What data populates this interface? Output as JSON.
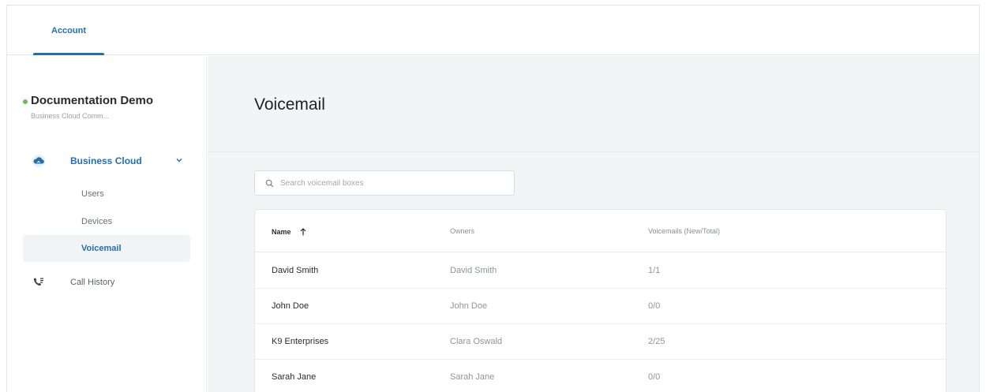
{
  "topbar": {
    "tab_account": "Account"
  },
  "sidebar": {
    "org_name": "Documentation Demo",
    "org_subtitle": "Business Cloud Comm...",
    "group_label": "Business Cloud",
    "items": [
      {
        "label": "Users"
      },
      {
        "label": "Devices"
      },
      {
        "label": "Voicemail"
      }
    ],
    "call_history": "Call History"
  },
  "main": {
    "title": "Voicemail",
    "search": {
      "placeholder": "Search voicemail boxes",
      "value": ""
    },
    "table": {
      "columns": {
        "name": "Name",
        "owners": "Owners",
        "voicemails": "Voicemails (New/Total)"
      },
      "rows": [
        {
          "name": "David Smith",
          "owner": "David Smith",
          "voicemails": "1/1"
        },
        {
          "name": "John Doe",
          "owner": "John Doe",
          "voicemails": "0/0"
        },
        {
          "name": "K9 Enterprises",
          "owner": "Clara Oswald",
          "voicemails": "2/25"
        },
        {
          "name": "Sarah Jane",
          "owner": "Sarah Jane",
          "voicemails": "0/0"
        }
      ]
    }
  },
  "colors": {
    "accent": "#1f6fb2",
    "status_online": "#6cc04a",
    "main_bg": "#f3f4f6"
  },
  "icons": {
    "group": "cloud-icon",
    "group_toggle": "chevron-down-icon",
    "call_history": "phone-list-icon",
    "search": "search-icon",
    "sort": "arrow-up-icon"
  }
}
